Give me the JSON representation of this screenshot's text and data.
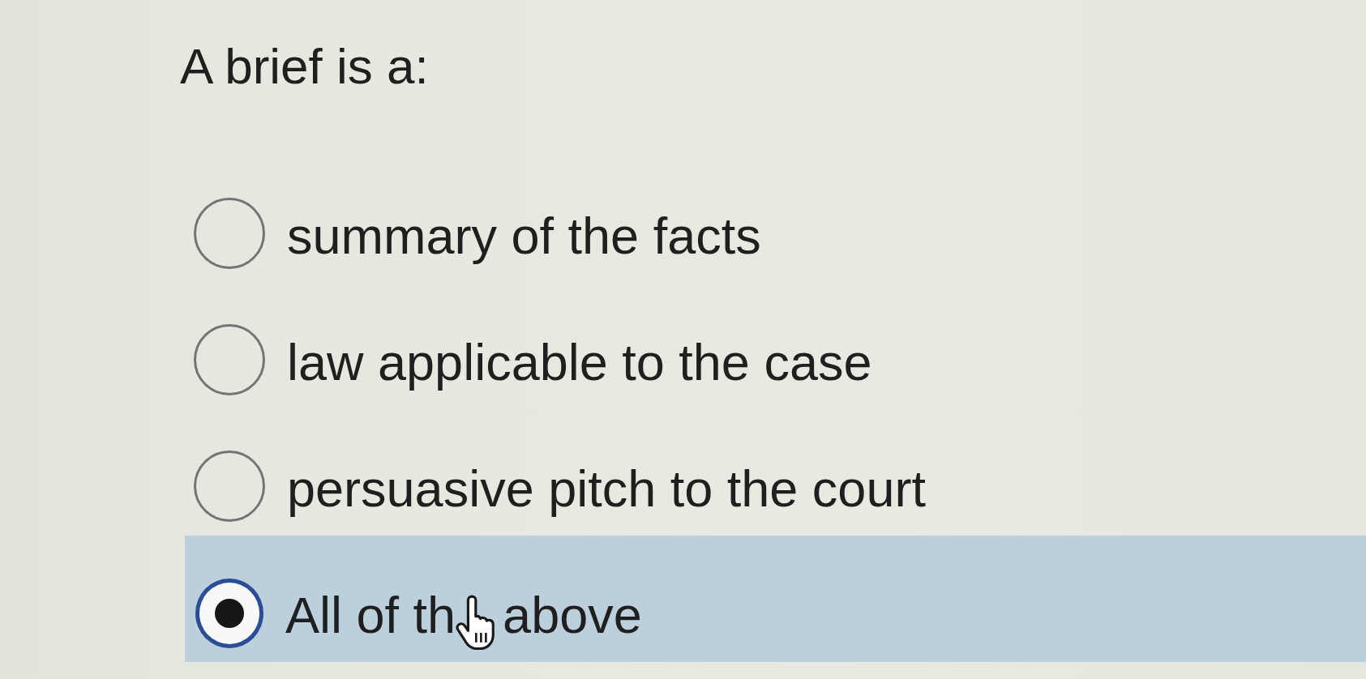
{
  "question": {
    "text": "A brief is a:"
  },
  "options": [
    {
      "label": "summary of the facts",
      "selected": false
    },
    {
      "label": "law applicable to the case",
      "selected": false
    },
    {
      "label": "persuasive pitch to the court",
      "selected": false
    },
    {
      "label": "All of th",
      "label_after_cursor": "above",
      "selected": true
    }
  ]
}
